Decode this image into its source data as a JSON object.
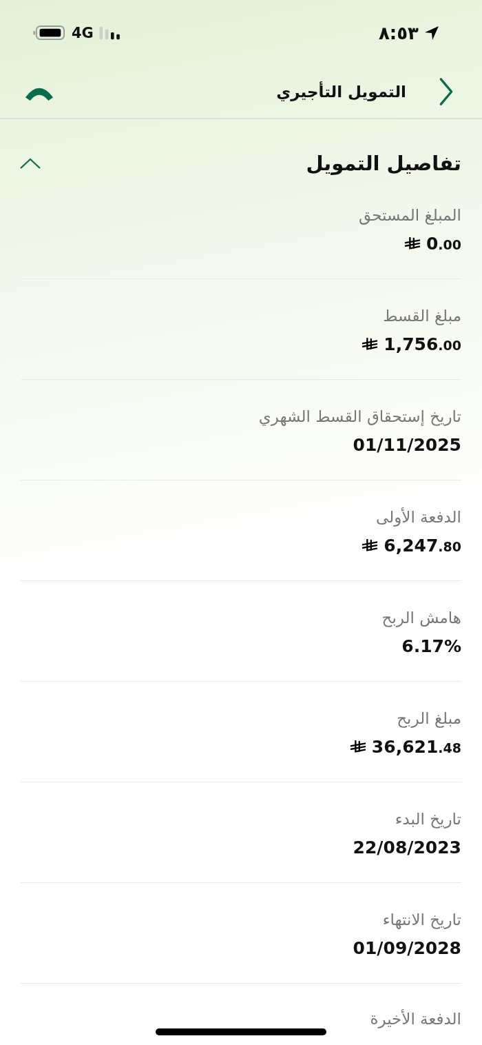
{
  "status_bar": {
    "time": "٨:٥٣",
    "network": "4G"
  },
  "header": {
    "title": "التمويل التأجيري"
  },
  "section": {
    "title": "تفاصيل التمويل",
    "expanded": true,
    "rows": [
      {
        "label": "المبلغ المستحق",
        "kind": "amount",
        "value": "0",
        "fraction": ".00"
      },
      {
        "label": "مبلغ القسط",
        "kind": "amount",
        "value": "1,756",
        "fraction": ".00"
      },
      {
        "label": "تاريخ إستحقاق القسط الشهري",
        "kind": "text",
        "value": "01/11/2025"
      },
      {
        "label": "الدفعة الأولى",
        "kind": "amount",
        "value": "6,247",
        "fraction": ".80"
      },
      {
        "label": "هامش الربح",
        "kind": "text",
        "value": "6.17%"
      },
      {
        "label": "مبلغ الربح",
        "kind": "amount",
        "value": "36,621",
        "fraction": ".48"
      },
      {
        "label": "تاريخ البدء",
        "kind": "text",
        "value": "22/08/2023"
      },
      {
        "label": "تاريخ الانتهاء",
        "kind": "text",
        "value": "01/09/2028"
      },
      {
        "label": "الدفعة الأخيرة",
        "kind": "label_only"
      }
    ]
  }
}
